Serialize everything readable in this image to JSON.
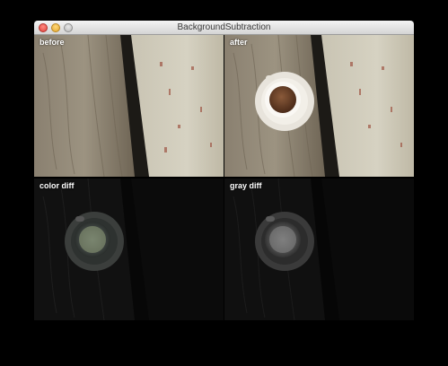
{
  "window": {
    "title": "BackgroundSubtraction"
  },
  "panes": {
    "before": {
      "label": "before"
    },
    "after": {
      "label": "after"
    },
    "color_diff": {
      "label": "color diff"
    },
    "gray_diff": {
      "label": "gray diff"
    }
  },
  "icons": {
    "close": "close-button-icon",
    "minimize": "minimize-button-icon",
    "zoom": "zoom-button-icon"
  }
}
